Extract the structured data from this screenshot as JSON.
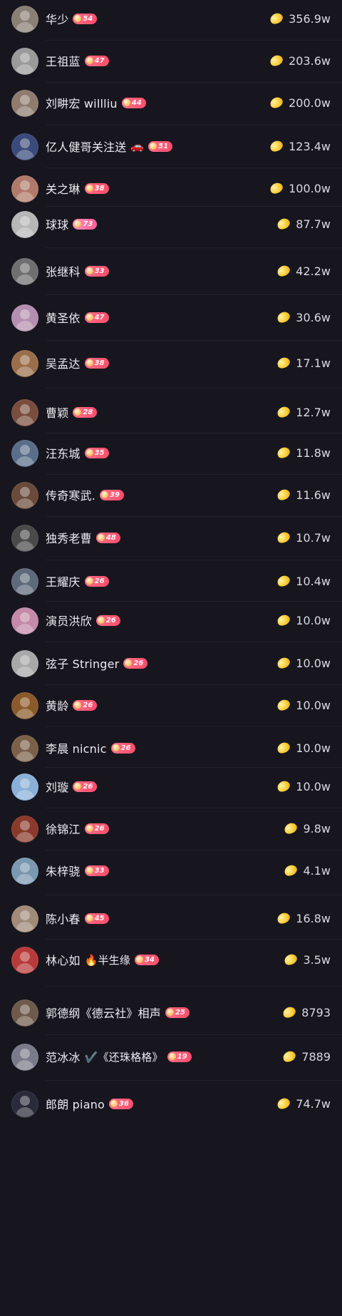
{
  "rows": [
    {
      "name": "华少",
      "level": "54",
      "extra": "",
      "value": "356.9w",
      "avatar": "#8a7f74"
    },
    {
      "name": "王祖蓝",
      "level": "47",
      "extra": "",
      "value": "203.6w",
      "avatar": "#9a9a9a"
    },
    {
      "name": "刘畊宏 willliu",
      "level": "44",
      "extra": "",
      "value": "200.0w",
      "avatar": "#8e7c6e"
    },
    {
      "name": "亿人健哥关注送",
      "level": "51",
      "extra": "🚗",
      "value": "123.4w",
      "avatar": "#3a4a7a"
    },
    {
      "name": "关之琳",
      "level": "38",
      "extra": "",
      "value": "100.0w",
      "avatar": "#b07a6a"
    },
    {
      "name": "球球",
      "level": "73",
      "extra": "",
      "value": "87.7w",
      "avatar": "#b7b7b7",
      "alt": true
    },
    {
      "name": "张继科",
      "level": "33",
      "extra": "",
      "value": "42.2w",
      "avatar": "#6f6f6f"
    },
    {
      "name": "黄圣依",
      "level": "47",
      "extra": "",
      "value": "30.6w",
      "avatar": "#b48fb0"
    },
    {
      "name": "吴孟达",
      "level": "38",
      "extra": "",
      "value": "17.1w",
      "avatar": "#9a6e4a"
    },
    {
      "name": "曹颖",
      "level": "28",
      "extra": "",
      "value": "12.7w",
      "avatar": "#7a4e3e"
    },
    {
      "name": "汪东城",
      "level": "35",
      "extra": "",
      "value": "11.8w",
      "avatar": "#5a6e8a"
    },
    {
      "name": "传奇寒武.",
      "level": "39",
      "extra": "",
      "value": "11.6w",
      "avatar": "#6a4a3a"
    },
    {
      "name": "独秀老曹",
      "level": "48",
      "extra": "",
      "value": "10.7w",
      "avatar": "#4a4a4a"
    },
    {
      "name": "王耀庆",
      "level": "26",
      "extra": "",
      "value": "10.4w",
      "avatar": "#5e6a7a"
    },
    {
      "name": "演员洪欣",
      "level": "26",
      "extra": "",
      "value": "10.0w",
      "avatar": "#c48aa8"
    },
    {
      "name": "弦子 Stringer",
      "level": "26",
      "extra": "",
      "value": "10.0w",
      "avatar": "#a8a8a8"
    },
    {
      "name": "黄龄",
      "level": "26",
      "extra": "",
      "value": "10.0w",
      "avatar": "#8a5a2a"
    },
    {
      "name": "李晨 nicnic",
      "level": "26",
      "extra": "",
      "value": "10.0w",
      "avatar": "#7a6048"
    },
    {
      "name": "刘璇",
      "level": "26",
      "extra": "",
      "value": "10.0w",
      "avatar": "#8ab0d8"
    },
    {
      "name": "徐锦江",
      "level": "26",
      "extra": "",
      "value": "9.8w",
      "avatar": "#8a3a2a"
    },
    {
      "name": "朱梓骁",
      "level": "33",
      "extra": "",
      "value": "4.1w",
      "avatar": "#7a98b0"
    },
    {
      "name": "陈小春",
      "level": "45",
      "extra": "",
      "value": "16.8w",
      "avatar": "#a08a78"
    },
    {
      "name": "林心如",
      "level": "34",
      "extra": "🔥半生缘",
      "value": "3.5w",
      "avatar": "#b83a3a"
    },
    {
      "name": "郭德纲《德云社》相声",
      "level": "25",
      "extra": "",
      "value": "8793",
      "avatar": "#6e5a4a"
    },
    {
      "name": "范冰冰",
      "level": "19",
      "extra": "✔️《还珠格格》",
      "value": "7889",
      "avatar": "#7a7a8a"
    },
    {
      "name": "郎朗 piano",
      "level": "36",
      "extra": "",
      "value": "74.7w",
      "avatar": "#2a2a3a"
    }
  ]
}
